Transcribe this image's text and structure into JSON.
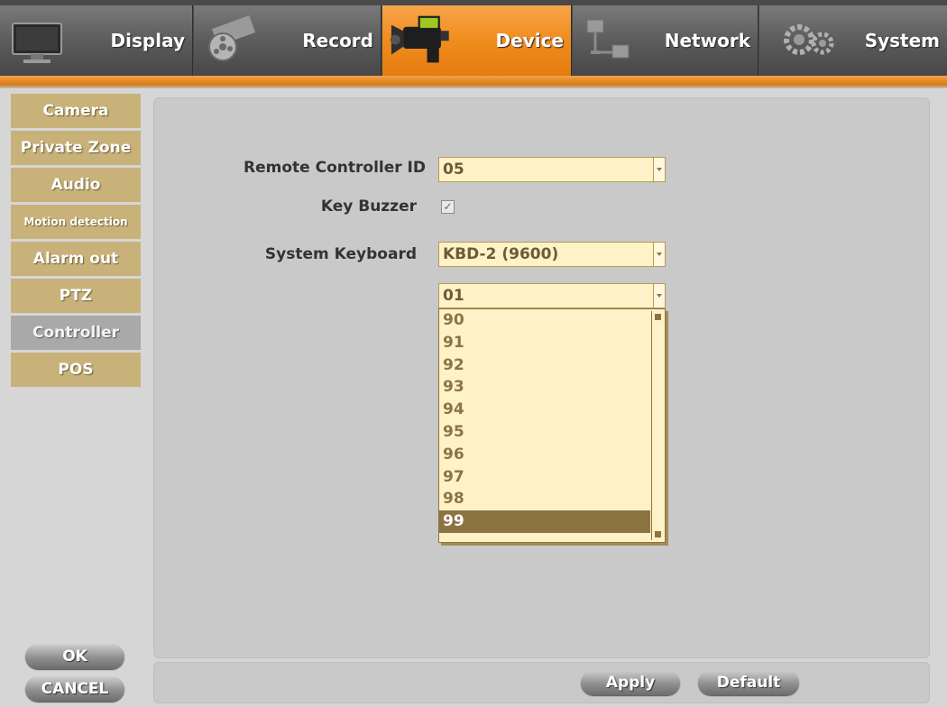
{
  "tabs": [
    {
      "label": "Display",
      "icon": "monitor-icon",
      "active": false
    },
    {
      "label": "Record",
      "icon": "film-reel-icon",
      "active": false
    },
    {
      "label": "Device",
      "icon": "video-camera-icon",
      "active": true
    },
    {
      "label": "Network",
      "icon": "network-icon",
      "active": false
    },
    {
      "label": "System",
      "icon": "gears-icon",
      "active": false
    }
  ],
  "sidebar": {
    "items": [
      {
        "label": "Camera"
      },
      {
        "label": "Private Zone"
      },
      {
        "label": "Audio"
      },
      {
        "label": "Motion detection"
      },
      {
        "label": "Alarm out"
      },
      {
        "label": "PTZ"
      },
      {
        "label": "Controller"
      },
      {
        "label": "POS"
      }
    ],
    "active_index": 6,
    "ok_label": "OK",
    "cancel_label": "CANCEL"
  },
  "form": {
    "remote_id_label": "Remote Controller ID",
    "remote_id_value": "05",
    "key_buzzer_label": "Key Buzzer",
    "key_buzzer_checked": true,
    "system_keyboard_label": "System Keyboard",
    "system_keyboard_value": "KBD-2 (9600)",
    "keyboard_id_value": "01"
  },
  "dropdown": {
    "options": [
      "90",
      "91",
      "92",
      "93",
      "94",
      "95",
      "96",
      "97",
      "98",
      "99"
    ],
    "selected": "99"
  },
  "footer": {
    "apply_label": "Apply",
    "default_label": "Default"
  },
  "colors": {
    "active_tab": "#f08c1e",
    "sidebar_item": "#c8b27a",
    "field_bg": "#fff2c6",
    "selected_option": "#8c7442"
  }
}
